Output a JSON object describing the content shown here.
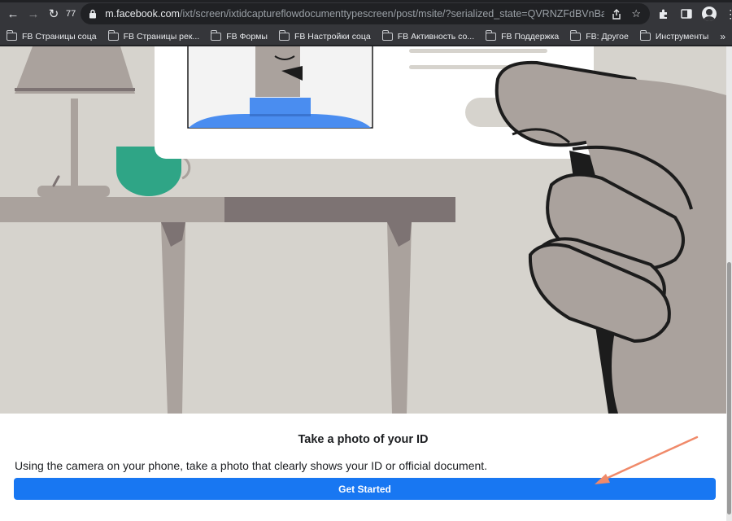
{
  "browser": {
    "tab_count": "77",
    "url_host": "m.facebook.com",
    "url_path": "/ixt/screen/ixtidcaptureflowdocumenttypescreen/post/msite/?serialized_state=QVRNZFdBVnBaOWU2a0FEZ...",
    "icons": [
      "back-icon",
      "forward-icon",
      "reload-icon",
      "lock-icon",
      "share-icon",
      "star-icon",
      "extensions-icon",
      "side-panel-icon",
      "profile-icon",
      "menu-icon"
    ]
  },
  "bookmarks": [
    {
      "label": "FB Страницы соца"
    },
    {
      "label": "FB Страницы рек..."
    },
    {
      "label": "FB Формы"
    },
    {
      "label": "FB Настройки соца"
    },
    {
      "label": "FB Активность со..."
    },
    {
      "label": "FB Поддержка"
    },
    {
      "label": "FB: Другое"
    },
    {
      "label": "Инструменты"
    }
  ],
  "bookmarks_more": "»",
  "page": {
    "title": "Take a photo of your ID",
    "description": "Using the camera on your phone, take a photo that clearly shows your ID or official document.",
    "button_label": "Get Started"
  },
  "colors": {
    "brand_button": "#1877f2",
    "annotation_arrow": "#f08a6a",
    "mug": "#2fa586",
    "shirt": "#4a8df0"
  }
}
